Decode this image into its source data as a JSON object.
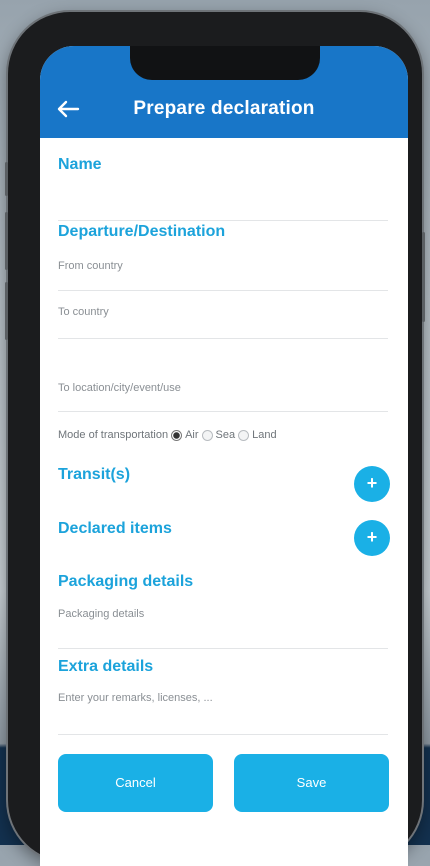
{
  "app": {
    "title": "Prepare declaration"
  },
  "sections": {
    "name": "Name",
    "departure": "Departure/Destination",
    "transits": "Transit(s)",
    "declared": "Declared items",
    "packaging": "Packaging details",
    "extra": "Extra details"
  },
  "fields": {
    "from_country": "From country",
    "to_country": "To country",
    "third_field": "To location/city/event/use",
    "packaging": "Packaging details",
    "extra": "Enter your remarks, licenses, ..."
  },
  "transport": {
    "label": "Mode of transportation",
    "options": [
      "Air",
      "Sea",
      "Land"
    ],
    "selected": "Air"
  },
  "actions": {
    "cancel": "Cancel",
    "save": "Save"
  },
  "colors": {
    "appbar": "#1876c8",
    "accent": "#1ca3db",
    "button": "#1ab0e6"
  },
  "icons": {
    "back": "arrow-left",
    "add": "plus"
  }
}
